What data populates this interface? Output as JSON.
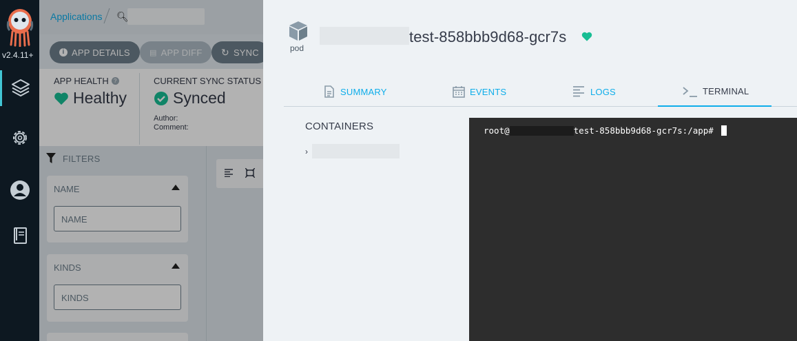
{
  "nav": {
    "version": "v2.4.11+",
    "items": [
      {
        "name": "applications-nav",
        "icon": "layers-icon"
      },
      {
        "name": "settings-nav",
        "icon": "gear-icon"
      },
      {
        "name": "user-nav",
        "icon": "user-icon"
      },
      {
        "name": "docs-nav",
        "icon": "docs-icon"
      }
    ]
  },
  "header": {
    "breadcrumb": "Applications",
    "search_placeholder": ""
  },
  "toolbar": {
    "app_details": "APP DETAILS",
    "app_diff": "APP DIFF",
    "sync": "SYNC"
  },
  "status": {
    "app_health_label": "APP HEALTH",
    "app_health_value": "Healthy",
    "sync_status_label": "CURRENT SYNC STATUS",
    "sync_status_value": "Synced",
    "author_label": "Author:",
    "comment_label": "Comment:"
  },
  "filters": {
    "header": "FILTERS",
    "name_title": "NAME",
    "name_placeholder": "NAME",
    "kinds_title": "KINDS",
    "kinds_placeholder": "KINDS"
  },
  "panel": {
    "kind_label": "pod",
    "resource_name": "test-858bbb9d68-gcr7s",
    "health_color": "#18be94",
    "tabs": [
      {
        "label": "SUMMARY",
        "icon": "file-icon"
      },
      {
        "label": "EVENTS",
        "icon": "calendar-icon"
      },
      {
        "label": "LOGS",
        "icon": "align-left-icon"
      },
      {
        "label": "TERMINAL",
        "icon": "terminal-icon"
      }
    ],
    "active_tab": "TERMINAL",
    "containers_title": "CONTAINERS"
  },
  "terminal": {
    "prompt_prefix": "root@",
    "prompt_suffix": "test-858bbb9d68-gcr7s:/app# "
  },
  "colors": {
    "accent": "#0dadea",
    "healthy": "#18be94",
    "nav_bg": "#0d1821",
    "terminal_bg": "#2d2d2d"
  }
}
